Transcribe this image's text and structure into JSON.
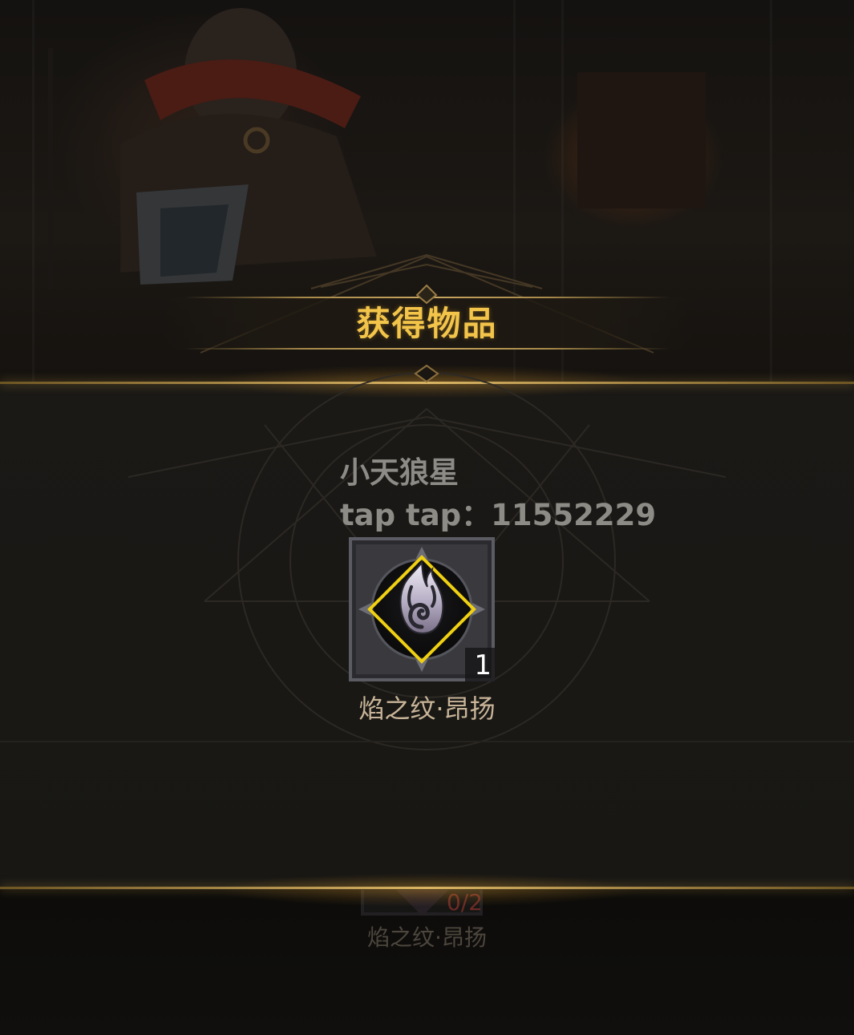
{
  "popup": {
    "title": "获得物品"
  },
  "watermark": {
    "line1": "小天狼星",
    "line2": "tap tap：11552229"
  },
  "reward_item": {
    "icon": "flame-rune-icon",
    "name": "焰之纹·昂扬",
    "count": "1",
    "frame_color": "#f0d012"
  },
  "background_item": {
    "icon": "flame-rune-icon",
    "name": "焰之纹·昂扬",
    "progress": "0/2"
  },
  "colors": {
    "title": "#f3c44a",
    "gold_line": "#d9b464",
    "item_name": "#c8b498"
  }
}
